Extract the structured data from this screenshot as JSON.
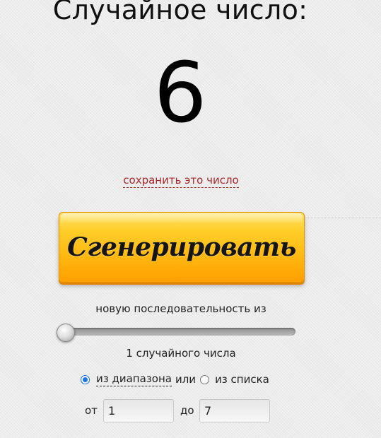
{
  "header": {
    "title": "Случайное число:"
  },
  "result": {
    "value": "6",
    "save_link": "сохранить это число"
  },
  "generate_button": {
    "label": "Сгенерировать"
  },
  "sequence": {
    "label": "новую последовательность из",
    "slider_value": 1,
    "count_label": "1 случайного числа"
  },
  "mode": {
    "range_label": "из диапазона",
    "or_word": "или",
    "list_label": "из списка",
    "selected": "range"
  },
  "range": {
    "from_label": "от",
    "from_value": "1",
    "to_label": "до",
    "to_value": "7"
  },
  "colors": {
    "button": "#ffb30d",
    "save_link": "#a52a2a",
    "radio_selected": "#1a73e8"
  }
}
